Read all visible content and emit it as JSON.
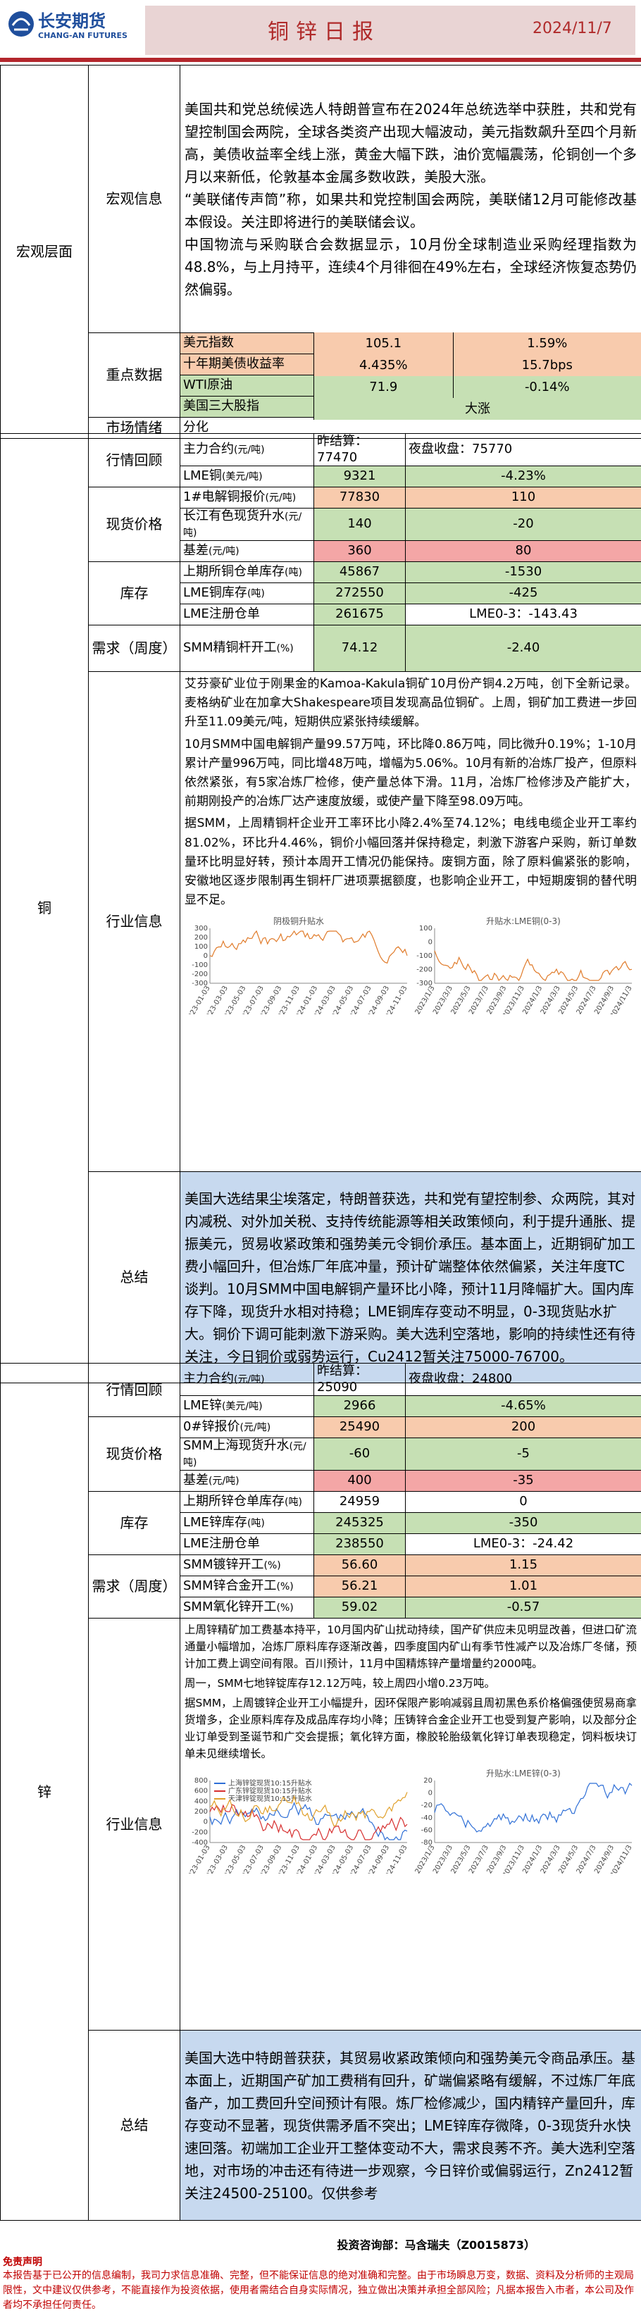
{
  "header": {
    "logo_cn": "长安期货",
    "logo_en": "CHANG-AN FUTURES",
    "title": "铜锌日报",
    "date": "2024/11/7"
  },
  "macro": {
    "section": "宏观层面",
    "info_label": "宏观信息",
    "info_paragraphs": [
      "美国共和党总统候选人特朗普宣布在2024年总统选举中获胜，共和党有望控制国会两院，全球各类资产出现大幅波动，美元指数飙升至四个月新高，美债收益率全线上涨，黄金大幅下跌，油价宽幅震荡，伦铜创一个多月以来新低，伦敦基本金属多数收跌，美股大涨。",
      "“美联储传声筒”称，如果共和党控制国会两院，美联储12月可能修改基本假设。关注即将进行的美联储会议。",
      "中国物流与采购联合会数据显示，10月份全球制造业采购经理指数为48.8%，与上月持平，连续4个月徘徊在49%左右，全球经济恢复态势仍然偏弱。"
    ],
    "key_label": "重点数据",
    "key_rows": [
      {
        "name": "美元指数",
        "value": "105.1",
        "change": "1.59%"
      },
      {
        "name": "十年期美债收益率",
        "value": "4.435%",
        "change": "15.7bps"
      },
      {
        "name": "WTI原油",
        "value": "71.9",
        "change": "-0.14%"
      },
      {
        "name": "美国三大股指",
        "value": "大涨",
        "change": ""
      }
    ],
    "mood_label": "市场情绪",
    "mood_value": "分化"
  },
  "copper": {
    "section": "铜",
    "review_label": "行情回顾",
    "main_label": "主力合约",
    "main_unit": "(元/吨)",
    "main_prev_label": "昨结算：",
    "main_prev": "77470",
    "main_night_label": "夜盘收盘：",
    "main_night": "75770",
    "lme_label": "LME铜",
    "lme_unit": "(美元/吨)",
    "lme_value": "9321",
    "lme_change": "-4.23%",
    "spot_label": "现货价格",
    "spot_rows": [
      {
        "name": "1#电解铜报价",
        "unit": "(元/吨)",
        "value": "77830",
        "change": "110"
      },
      {
        "name": "长江有色现货升水",
        "unit": "(元/吨)",
        "value": "140",
        "change": "-20"
      },
      {
        "name": "基差",
        "unit": "(元/吨)",
        "value": "360",
        "change": "80"
      }
    ],
    "inv_label": "库存",
    "inv_rows": [
      {
        "name": "上期所铜仓单库存",
        "unit": "(吨)",
        "value": "45867",
        "change": "-1530"
      },
      {
        "name": "LME铜库存",
        "unit": "(吨)",
        "value": "272550",
        "change": "-425"
      },
      {
        "name": "LME注册仓单",
        "unit": "",
        "value": "261675",
        "change": "LME0-3：-143.43"
      }
    ],
    "demand_label": "需求（周度）",
    "demand_rows": [
      {
        "name": "SMM精铜杆开工",
        "unit": "(%)",
        "value": "74.12",
        "change": "-2.40"
      }
    ],
    "industry_label": "行业信息",
    "industry_text": [
      "艾芬豪矿业位于刚果金的Kamoa-Kakula铜矿10月份产铜4.2万吨，创下全新记录。麦格纳矿业在加拿大Shakespeare项目发现高品位铜矿。上周，铜矿加工费进一步回升至11.09美元/吨，短期供应紧张持续缓解。",
      "10月SMM中国电解铜产量99.57万吨，环比降0.86万吨，同比微升0.19%；1-10月累计产量996万吨，同比增48万吨，增幅为5.06%。10月有新的冶炼厂投产，但原料依然紧张，有5家冶炼厂检修，使产量总体下滑。11月，冶炼厂检修涉及产能扩大，前期刚投产的冶炼厂达产速度放缓，或使产量下降至98.09万吨。",
      "据SMM，上周精铜杆企业开工率环比小降2.4%至74.12%；电线电缆企业开工率约81.02%，环比升4.46%，铜价小幅回落并保持稳定，刺激下游客户采购，新订单数量环比明显好转，预计本周开工情况仍能保持。废铜方面，除了原料偏紧张的影响，安徽地区逐步限制再生铜杆厂进项票据额度，也影响企业开工，中短期废铜的替代明显不足。"
    ],
    "chart1_title": "阴极铜升贴水",
    "chart2_title": "升贴水:LME铜(0-3)",
    "chart1_ticks": [
      "2023-01-03",
      "2023-03-03",
      "2023-05-03",
      "2023-07-03",
      "2023-09-03",
      "2023-11-03",
      "2024-01-03",
      "2024-03-03",
      "2024-05-03",
      "2024-07-03",
      "2024-09-03",
      "2024-11-03"
    ],
    "chart1_yticks": [
      "300",
      "200",
      "100",
      "0",
      "-100",
      "-200",
      "-300"
    ],
    "chart2_ticks": [
      "2023/1/3",
      "2023/3/3",
      "2023/5/3",
      "2023/7/3",
      "2023/9/3",
      "2023/11/3",
      "2024/1/3",
      "2024/3/3",
      "2024/5/3",
      "2024/7/3",
      "2024/9/3",
      "2024/11/3"
    ],
    "chart2_yticks": [
      "100",
      "0",
      "-100",
      "-200",
      "-300"
    ],
    "summary_label": "总结",
    "summary_text": "美国大选结果尘埃落定，特朗普获选，共和党有望控制参、众两院，其对内减税、对外加关税、支持传统能源等相关政策倾向，利于提升通胀、提振美元，贸易收紧政策和强势美元令铜价承压。基本面上，近期铜矿加工费小幅回升，但冶炼厂年底冲量，预计矿端整体依然偏紧，关注年度TC谈判。10月SMM中国电解铜产量环比小降，预计11月降幅扩大。国内库存下降，现货升水相对持稳；LME铜库存变动不明显，0-3现货贴水扩大。铜价下调可能刺激下游采购。美大选利空落地，影响的持续性还有待关注，今日铜价或弱势运行，Cu2412暂关注75000-76700。"
  },
  "zinc": {
    "section": "锌",
    "review_label": "行情回顾",
    "main_label": "主力合约",
    "main_unit": "(元/吨)",
    "main_prev_label": "昨结算：",
    "main_prev": "25090",
    "main_night_label": "夜盘收盘：",
    "main_night": "24800",
    "lme_label": "LME锌",
    "lme_unit": "(美元/吨)",
    "lme_value": "2966",
    "lme_change": "-4.65%",
    "spot_label": "现货价格",
    "spot_rows": [
      {
        "name": "0#锌报价",
        "unit": "(元/吨)",
        "value": "25490",
        "change": "200"
      },
      {
        "name": "SMM上海现货升水",
        "unit": "(元/吨)",
        "value": "-60",
        "change": "-5"
      },
      {
        "name": "基差",
        "unit": "(元/吨)",
        "value": "400",
        "change": "-35"
      }
    ],
    "inv_label": "库存",
    "inv_rows": [
      {
        "name": "上期所锌仓单库存",
        "unit": "(吨)",
        "value": "24959",
        "change": "0"
      },
      {
        "name": "LME锌库存",
        "unit": "(吨)",
        "value": "245325",
        "change": "-350"
      },
      {
        "name": "LME注册仓单",
        "unit": "",
        "value": "238550",
        "change": "LME0-3：-24.42"
      }
    ],
    "demand_label": "需求（周度）",
    "demand_rows": [
      {
        "name": "SMM镀锌开工",
        "unit": "(%)",
        "value": "56.60",
        "change": "1.15"
      },
      {
        "name": "SMM锌合金开工",
        "unit": "(%)",
        "value": "56.21",
        "change": "1.01"
      },
      {
        "name": "SMM氧化锌开工",
        "unit": "(%)",
        "value": "59.02",
        "change": "-0.57"
      }
    ],
    "industry_label": "行业信息",
    "industry_text": [
      "上周锌精矿加工费基本持平，10月国内矿山扰动持续，国产矿供应未见明显改善，但进口矿流通量小幅增加，冶炼厂原料库存逐渐改善，四季度国内矿山有季节性减产以及冶炼厂冬储，预计加工费上调空间有限。百川预计，11月中国精炼锌产量增量约2000吨。",
      "周一，SMM七地锌锭库存12.12万吨，较上周四小增0.23万吨。",
      "据SMM，上周镀锌企业开工小幅提升，因环保限产影响减弱且周初黑色系价格偏强使贸易商拿货增多，企业原料库存及成品库存均小降；压铸锌合金企业开工也受到复产影响，以及部分企业订单受到圣诞节和广交会提振；氧化锌方面，橡胶轮胎级氧化锌订单表现稳定，饲料板块订单未见继续增长。"
    ],
    "chart1_legend": [
      "上海锌锭现货10:15升贴水",
      "广东锌锭现货10:15升贴水",
      "天津锌锭现货10:15升贴水"
    ],
    "chart2_title": "升贴水:LME锌(0-3)",
    "chart1_ticks": [
      "2023-01-03",
      "2023-03-03",
      "2023-05-03",
      "2023-07-03",
      "2023-09-03",
      "2023-11-03",
      "2024-01-03",
      "2024-03-03",
      "2024-05-03",
      "2024-07-03",
      "2024-09-03",
      "2024-11-03"
    ],
    "chart1_yticks": [
      "800",
      "600",
      "400",
      "200",
      "0",
      "-200",
      "-400"
    ],
    "chart2_ticks": [
      "2023/1/3",
      "2023/3/3",
      "2023/5/3",
      "2023/7/3",
      "2023/9/3",
      "2023/11/3",
      "2024/1/3",
      "2024/3/3",
      "2024/5/3",
      "2024/7/3",
      "2024/9/3",
      "2024/11/3"
    ],
    "chart2_yticks": [
      "20",
      "0",
      "-20",
      "-40",
      "-60",
      "-80"
    ],
    "summary_label": "总结",
    "summary_text": "美国大选中特朗普获获，其贸易收紧政策倾向和强势美元令商品承压。基本面上，近期国产矿加工费稍有回升，矿端偏紧略有缓解，不过炼厂年底备产，加工费回升空间预计有限。炼厂检修减少，国内精锌产量回升，库存变动不显著，现货供需矛盾不突出；LME锌库存微降，0-3现货升水快速回落。初端加工企业开工整体变动不大，需求良莠不齐。美大选利空落地，对市场的冲击还有待进一步观察，今日锌价或偏弱运行，Zn2412暂关注24500-25100。仅供参考"
  },
  "footer": {
    "consultant": "投资咨询部：马含瑞夫（Z0015873）",
    "disclaimer_title": "免责声明",
    "disclaimer": "本报告基于已公开的信息编制，我司力求信息准确、完整，但不能保证信息的绝对准确和完整。由于市场瞬息万变，数据、资料及分析师的主观局限性，文中建议仅供参考，不能直接作为投资依据，使用者需结合自身实际情况，独立做出决策并承担全部风险；凡据本报告入市者，本公司及作者均不承担任何责任。"
  },
  "colors": {
    "brand": "#b3262c",
    "header_band": "#e9d4d4",
    "orange": "#f8cbad",
    "green": "#c6e0b4",
    "pink": "#f4a6a6",
    "summary": "#c7d9ef"
  }
}
